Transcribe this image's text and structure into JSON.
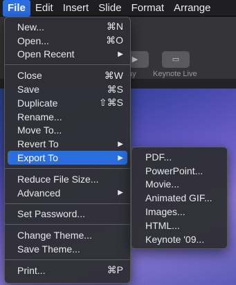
{
  "menubar": [
    "File",
    "Edit",
    "Insert",
    "Slide",
    "Format",
    "Arrange"
  ],
  "toolbar": {
    "play_caption": "ay",
    "keynote_live_caption": "Keynote Live"
  },
  "file_menu": {
    "groups": [
      [
        {
          "label": "New...",
          "shortcut": "⌘N"
        },
        {
          "label": "Open...",
          "shortcut": "⌘O"
        },
        {
          "label": "Open Recent",
          "submenu": true
        }
      ],
      [
        {
          "label": "Close",
          "shortcut": "⌘W"
        },
        {
          "label": "Save",
          "shortcut": "⌘S"
        },
        {
          "label": "Duplicate",
          "shortcut": "⇧⌘S"
        },
        {
          "label": "Rename..."
        },
        {
          "label": "Move To..."
        },
        {
          "label": "Revert To",
          "submenu": true
        },
        {
          "label": "Export To",
          "submenu": true,
          "highlighted": true
        }
      ],
      [
        {
          "label": "Reduce File Size..."
        },
        {
          "label": "Advanced",
          "submenu": true
        }
      ],
      [
        {
          "label": "Set Password..."
        }
      ],
      [
        {
          "label": "Change Theme..."
        },
        {
          "label": "Save Theme..."
        }
      ],
      [
        {
          "label": "Print...",
          "shortcut": "⌘P"
        }
      ]
    ]
  },
  "export_submenu": [
    "PDF...",
    "PowerPoint...",
    "Movie...",
    "Animated GIF...",
    "Images...",
    "HTML...",
    "Keynote '09..."
  ],
  "colors": {
    "highlight": "#2a6ee0",
    "menu_bg": "#303036"
  }
}
